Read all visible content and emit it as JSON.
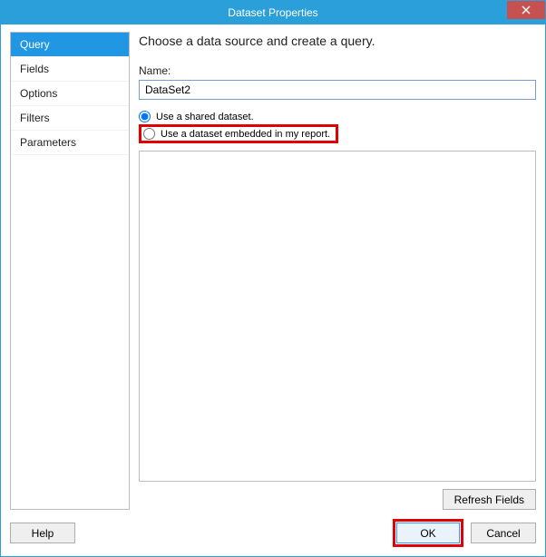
{
  "window": {
    "title": "Dataset Properties"
  },
  "sidebar": {
    "items": [
      {
        "label": "Query",
        "selected": true
      },
      {
        "label": "Fields",
        "selected": false
      },
      {
        "label": "Options",
        "selected": false
      },
      {
        "label": "Filters",
        "selected": false
      },
      {
        "label": "Parameters",
        "selected": false
      }
    ]
  },
  "content": {
    "heading": "Choose a data source and create a query.",
    "name_label": "Name:",
    "name_value": "DataSet2",
    "radio_shared": "Use a shared dataset.",
    "radio_embedded": "Use a dataset embedded in my report.",
    "selected_radio": "shared",
    "refresh_label": "Refresh Fields"
  },
  "footer": {
    "help_label": "Help",
    "ok_label": "OK",
    "cancel_label": "Cancel"
  }
}
